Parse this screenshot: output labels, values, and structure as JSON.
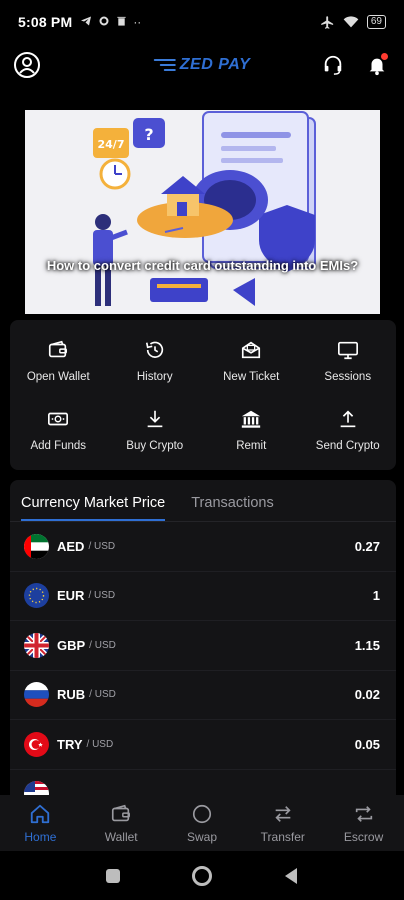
{
  "status_bar": {
    "time": "5:08 PM",
    "battery": "69"
  },
  "app": {
    "logo_text": "ZED PAY"
  },
  "banner": {
    "caption": "How to convert credit card outstanding into EMIs?",
    "badge_text": "24/7"
  },
  "quick_actions": [
    {
      "label": "Open Wallet",
      "icon": "wallet-icon"
    },
    {
      "label": "History",
      "icon": "history-icon"
    },
    {
      "label": "New Ticket",
      "icon": "ticket-icon"
    },
    {
      "label": "Sessions",
      "icon": "monitor-icon"
    },
    {
      "label": "Add Funds",
      "icon": "cash-icon"
    },
    {
      "label": "Buy Crypto",
      "icon": "download-icon"
    },
    {
      "label": "Remit",
      "icon": "bank-icon"
    },
    {
      "label": "Send Crypto",
      "icon": "upload-icon"
    }
  ],
  "market": {
    "tabs": [
      {
        "label": "Currency Market Price"
      },
      {
        "label": "Transactions"
      }
    ],
    "active_tab": "Currency Market Price",
    "rows": [
      {
        "code": "AED",
        "base": "/ USD",
        "value": "0.27"
      },
      {
        "code": "EUR",
        "base": "/ USD",
        "value": "1"
      },
      {
        "code": "GBP",
        "base": "/ USD",
        "value": "1.15"
      },
      {
        "code": "RUB",
        "base": "/ USD",
        "value": "0.02"
      },
      {
        "code": "TRY",
        "base": "/ USD",
        "value": "0.05"
      }
    ]
  },
  "bottom_nav": [
    {
      "label": "Home",
      "icon": "home-icon"
    },
    {
      "label": "Wallet",
      "icon": "wallet-icon"
    },
    {
      "label": "Swap",
      "icon": "circle-icon"
    },
    {
      "label": "Transfer",
      "icon": "transfer-icon"
    },
    {
      "label": "Escrow",
      "icon": "escrow-icon"
    }
  ],
  "colors": {
    "accent": "#2f6fd3",
    "background": "#000000",
    "card": "#141416"
  }
}
